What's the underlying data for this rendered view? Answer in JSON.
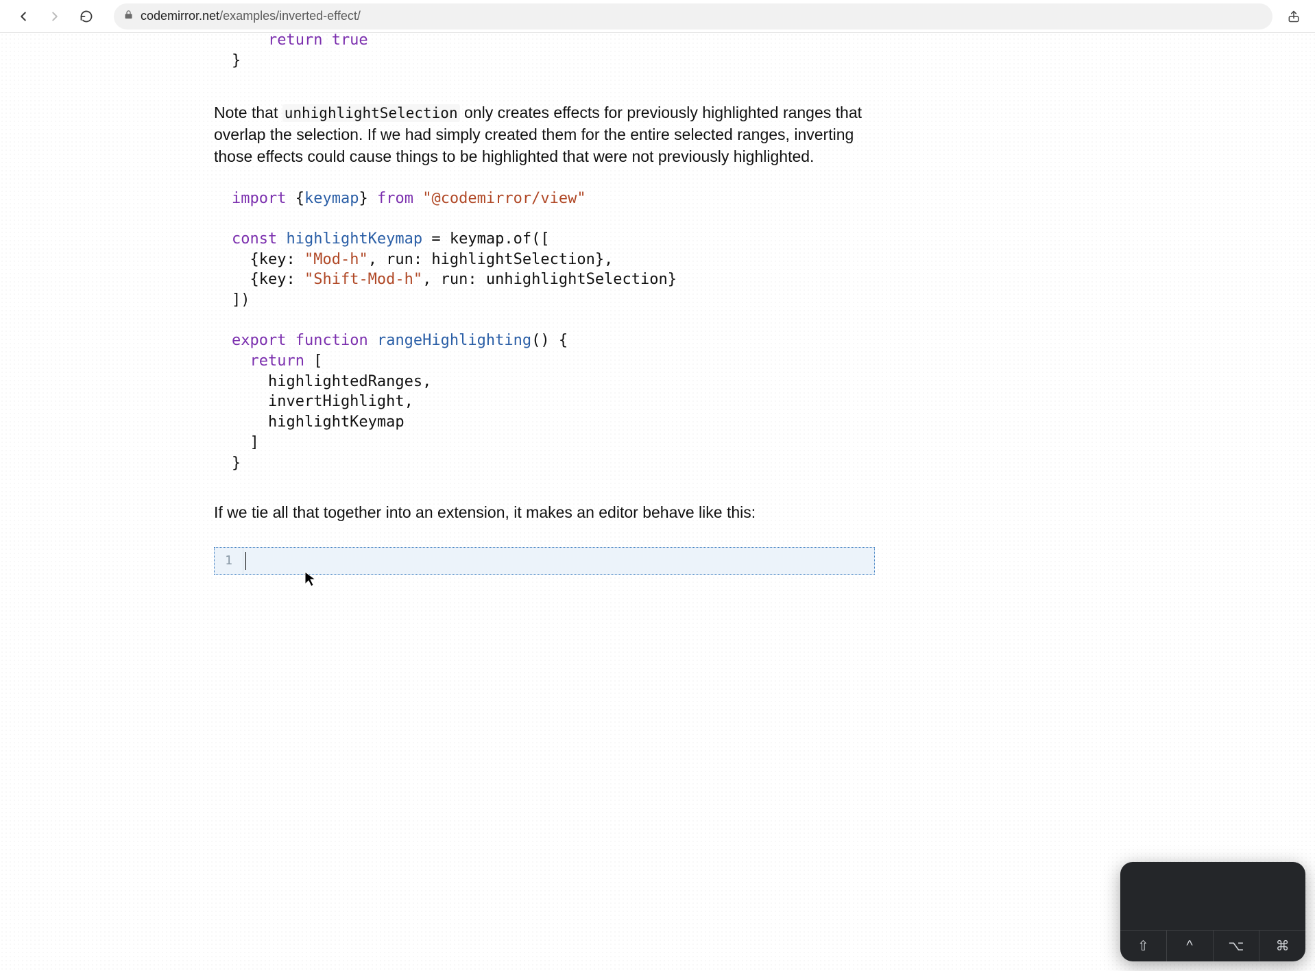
{
  "browser": {
    "url_host": "codemirror.net",
    "url_path": "/examples/inverted-effect/"
  },
  "codeFragmentTop": {
    "l1": "    return true",
    "l2": "}"
  },
  "paragraph1": {
    "before_code": "Note that ",
    "code": "unhighlightSelection",
    "after_code": " only creates effects for previously highlighted ranges that overlap the selection. If we had simply created them for the entire selected ranges, inverting those effects could cause things to be highlighted that were not previously highlighted."
  },
  "codeBlock": {
    "l1_import": "import",
    "l1_brace_o": " {",
    "l1_keymap": "keymap",
    "l1_brace_c": "} ",
    "l1_from": "from",
    "l1_pkg": " \"@codemirror/view\"",
    "blank1": "",
    "l2_const": "const",
    "l2_name": " highlightKeymap",
    "l2_rest": " = keymap.of([",
    "l3_a": "  {key: ",
    "l3_str": "\"Mod-h\"",
    "l3_b": ", run: highlightSelection},",
    "l4_a": "  {key: ",
    "l4_str": "\"Shift-Mod-h\"",
    "l4_b": ", run: unhighlightSelection}",
    "l5": "])",
    "blank2": "",
    "l6_export": "export",
    "l6_function": " function",
    "l6_name": " rangeHighlighting",
    "l6_rest": "() {",
    "l7_return": "  return",
    "l7_rest": " [",
    "l8": "    highlightedRanges,",
    "l9": "    invertHighlight,",
    "l10": "    highlightKeymap",
    "l11": "  ]",
    "l12": "}"
  },
  "paragraph2": "If we tie all that together into an extension, it makes an editor behave like this:",
  "editor": {
    "line_number": "1",
    "content": ""
  },
  "floatPanel": {
    "buttons": [
      "shift",
      "ctrl",
      "option",
      "command"
    ],
    "glyphs": [
      "⇧",
      "^",
      "⌥",
      "⌘"
    ]
  }
}
